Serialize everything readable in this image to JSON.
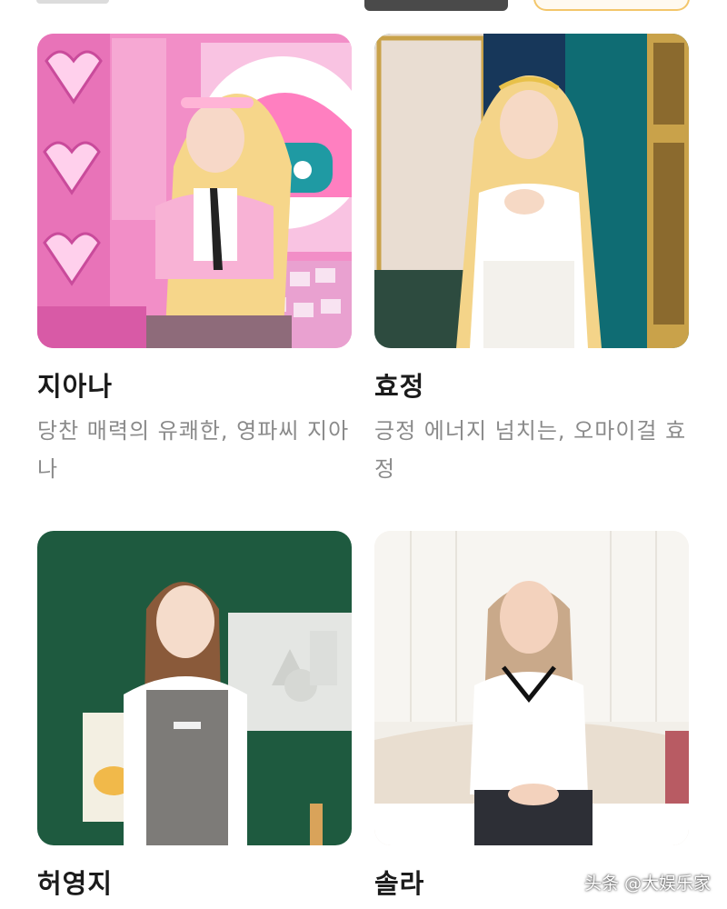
{
  "profiles": [
    {
      "name": "지아나",
      "description": "당찬 매력의 유쾌한, 영파씨 지아나",
      "image_alt": "지아나 profile photo"
    },
    {
      "name": "효정",
      "description": "긍정 에너지 넘치는, 오마이걸 효정",
      "image_alt": "효정 profile photo"
    },
    {
      "name": "허영지",
      "description": "",
      "image_alt": "허영지 profile photo"
    },
    {
      "name": "솔라",
      "description": "",
      "image_alt": "솔라 profile photo"
    }
  ],
  "watermark": "头条 @大娱乐家"
}
